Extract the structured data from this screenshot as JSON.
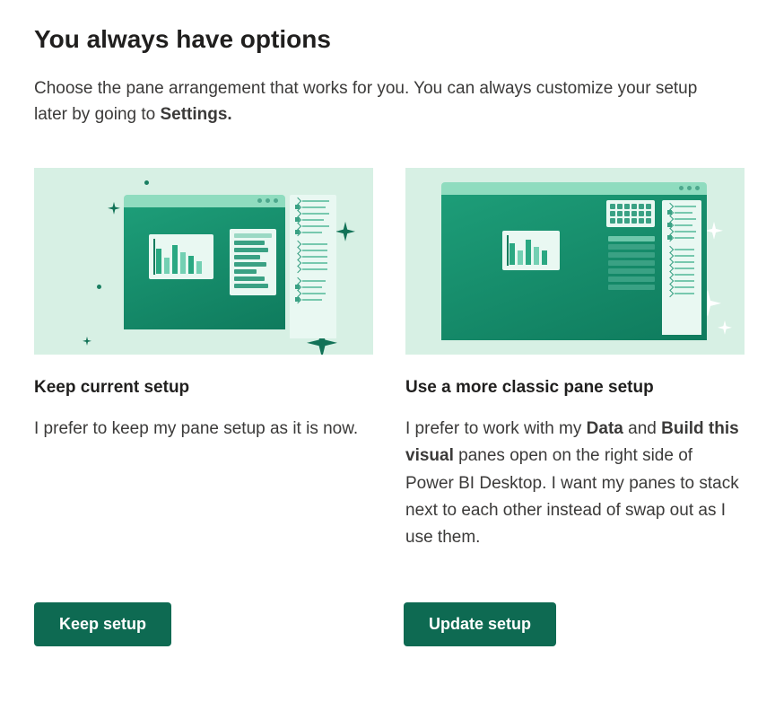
{
  "title": "You always have options",
  "subtitle_before": "Choose the pane arrangement that works for you. You can always customize your setup later by going to ",
  "subtitle_bold": "Settings.",
  "option_keep": {
    "title": "Keep current setup",
    "desc": "I prefer to keep my pane setup as it is now.",
    "button": "Keep setup"
  },
  "option_classic": {
    "title": "Use a more classic pane setup",
    "desc_1": "I prefer to work with my ",
    "bold_1": "Data",
    "desc_2": " and ",
    "bold_2": "Build this visual",
    "desc_3": " panes open on the right side of Power BI Desktop. I want my panes to stack next to each other instead of swap out as I use them.",
    "button": "Update setup"
  }
}
